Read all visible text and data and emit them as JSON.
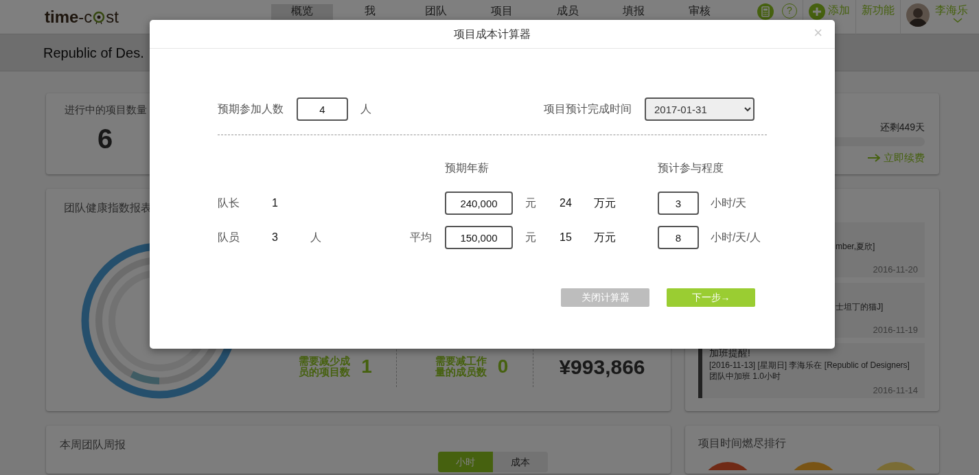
{
  "header": {
    "logo": {
      "word": "time",
      "joiner": "-c",
      "tail": "st"
    },
    "nav": [
      {
        "label": "概览",
        "selected": true
      },
      {
        "label": "我",
        "selected": false
      },
      {
        "label": "团队",
        "selected": false
      },
      {
        "label": "项目",
        "selected": false
      },
      {
        "label": "成员",
        "selected": false
      },
      {
        "label": "填报",
        "selected": false
      },
      {
        "label": "审核",
        "selected": false
      }
    ],
    "help_glyph": "?",
    "add_label": "添加",
    "new_feature": "新功能",
    "user_name": "李海乐"
  },
  "project_bar": {
    "title": "Republic of Des."
  },
  "project_count_card": {
    "title": "进行中的项目数量",
    "value": "6"
  },
  "subscription_card": {
    "remaining": "还剩449天",
    "renew_link": "立即续费"
  },
  "health_card": {
    "title": "团队健康指数报表",
    "stats": [
      {
        "kind": "alert",
        "label": "需要减少成员的项目数",
        "value": "1"
      },
      {
        "kind": "alert",
        "label": "需要减工作量的成员数",
        "value": "0"
      },
      {
        "kind": "money",
        "value": "¥993,866"
      }
    ]
  },
  "notices_card": {
    "items": [
      {
        "kind": "partial",
        "text": "mber,夏欣]",
        "date": "2016-11-20"
      },
      {
        "kind": "partial",
        "text": "士坦丁的猫J]",
        "date": "2016-11-19"
      },
      {
        "kind": "full",
        "title": "加班提醒!",
        "text": "[2016-11-13] [星期日] 李海乐在 [Republic of Designers] 团队中加班 1.0小时",
        "date": "2016-11-14"
      }
    ]
  },
  "weekly_card": {
    "title": "本周团队周报",
    "toggle": [
      {
        "label": "小时",
        "selected": true
      },
      {
        "label": "成本",
        "selected": false
      }
    ]
  },
  "burndown_card": {
    "title": "项目时间燃尽排行"
  },
  "calculator": {
    "title": "项目成本计算器",
    "close_glyph": "×",
    "headcount_label": "预期参加人数",
    "headcount": "4",
    "headcount_unit": "人",
    "deadline_label": "项目预计完成时间",
    "deadline": "2017-01-31",
    "salary_heading": "预期年薪",
    "involvement_heading": "预计参与程度",
    "rows": [
      {
        "role": "队长",
        "count": "1",
        "salary": "240,000",
        "salary_unit": "元",
        "salary_wan": "24",
        "wan_unit": "万元",
        "hours": "3",
        "hours_unit": "小时/天"
      },
      {
        "role": "队员",
        "count": "3",
        "count_unit": "人",
        "avg_label": "平均",
        "salary": "150,000",
        "salary_unit": "元",
        "salary_wan": "15",
        "wan_unit": "万元",
        "hours": "8",
        "hours_unit": "小时/天/人"
      }
    ],
    "buttons": [
      {
        "kind": "secondary",
        "label": "关闭计算器"
      },
      {
        "kind": "primary",
        "label": "下一步→"
      }
    ]
  }
}
